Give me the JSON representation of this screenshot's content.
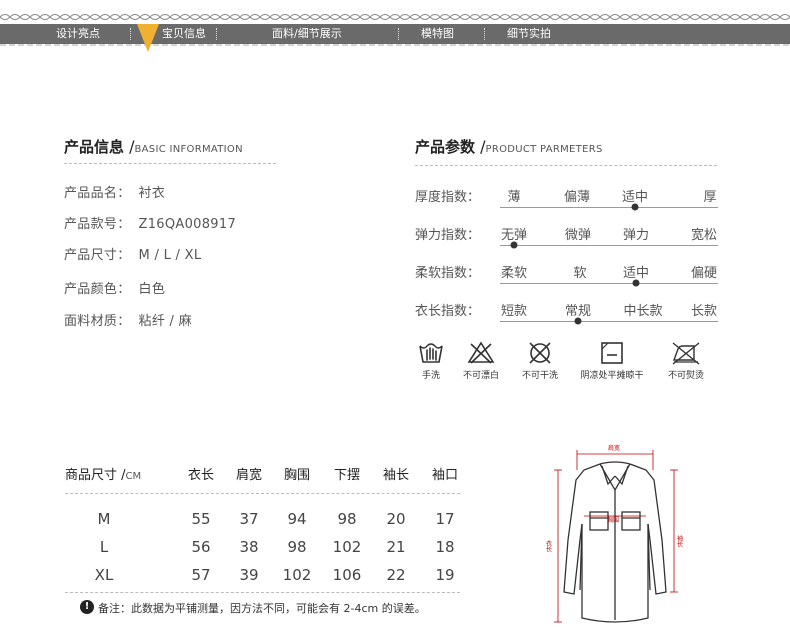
{
  "nav": {
    "items": [
      "设计亮点",
      "宝贝信息",
      "面料/细节展示",
      "模特图",
      "细节实拍"
    ]
  },
  "basic": {
    "title_cn": "产品信息",
    "title_slash": "/",
    "title_en": "BASIC INFORMATION",
    "rows": [
      {
        "label": "产品品名：",
        "value": "衬衣"
      },
      {
        "label": "产品款号：",
        "value": "Z16QA008917"
      },
      {
        "label": "产品尺寸：",
        "value": "M / L / XL"
      },
      {
        "label": "产品颜色：",
        "value": "白色"
      },
      {
        "label": "面料材质：",
        "value": "粘纤 / 麻"
      }
    ]
  },
  "params": {
    "title_cn": "产品参数",
    "title_slash": "/",
    "title_en": "PRODUCT PARMETERS",
    "rows": [
      {
        "label": "厚度指数：",
        "options": [
          "薄",
          "偏薄",
          "适中",
          "厚"
        ],
        "selected_index": 2
      },
      {
        "label": "弹力指数：",
        "options": [
          "无弹",
          "微弹",
          "弹力",
          "宽松"
        ],
        "selected_index": 0
      },
      {
        "label": "柔软指数：",
        "options": [
          "柔软",
          "软",
          "适中",
          "偏硬"
        ],
        "selected_index": 2
      },
      {
        "label": "衣长指数：",
        "options": [
          "短款",
          "常规",
          "中长款",
          "长款"
        ],
        "selected_index": 1
      }
    ]
  },
  "care": [
    {
      "icon": "hand-wash-icon",
      "label": "手洗"
    },
    {
      "icon": "no-bleach-icon",
      "label": "不可漂白"
    },
    {
      "icon": "no-dry-clean-icon",
      "label": "不可干洗"
    },
    {
      "icon": "dry-flat-shade-icon",
      "label": "阴凉处平摊晾干"
    },
    {
      "icon": "no-iron-icon",
      "label": "不可熨烫"
    }
  ],
  "size_table": {
    "header_first": "商品尺寸 /",
    "header_unit": "CM",
    "columns": [
      "衣长",
      "肩宽",
      "胸围",
      "下摆",
      "袖长",
      "袖口"
    ],
    "rows": [
      {
        "size": "M",
        "values": [
          "55",
          "37",
          "94",
          "98",
          "20",
          "17"
        ]
      },
      {
        "size": "L",
        "values": [
          "56",
          "38",
          "98",
          "102",
          "21",
          "18"
        ]
      },
      {
        "size": "XL",
        "values": [
          "57",
          "39",
          "102",
          "106",
          "22",
          "19"
        ]
      }
    ]
  },
  "note": {
    "icon": "!",
    "text": "备注：此数据为平铺测量，因方法不同，可能会有 2-4cm 的误差。"
  },
  "diagram": {
    "shoulder_label": "肩宽",
    "chest_label": "胸围",
    "length_label": "衣长",
    "sleeve_label": "袖长"
  },
  "colors": {
    "nav_bg": "#6a6a6a",
    "accent": "#f0b030",
    "measure": "#c00000"
  }
}
